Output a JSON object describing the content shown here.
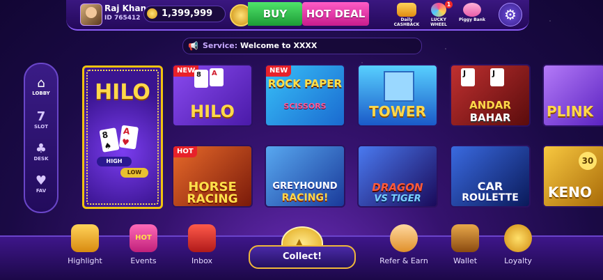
{
  "header": {
    "user_name": "Raj Khan",
    "user_id": "ID 765412",
    "balance": "1,399,999",
    "buy_label": "BUY",
    "hot_deal_label": "HOT DEAL",
    "promos": [
      {
        "name": "daily-cashback",
        "label": "Daily CASHBACK",
        "color": "#f0a030"
      },
      {
        "name": "lucky-wheel",
        "label": "LUCKY WHEEL",
        "color": "#e04c90",
        "badge": "1"
      },
      {
        "name": "piggy-bank",
        "label": "Piggy Bank",
        "color": "#f07ab8"
      }
    ]
  },
  "service": {
    "label": "Service:",
    "message": "Welcome to XXXX"
  },
  "sidebar": {
    "items": [
      {
        "label": "LOBBY",
        "icon": "home-icon",
        "active": true
      },
      {
        "label": "SLOT",
        "icon": "seven-icon"
      },
      {
        "label": "DESK",
        "icon": "club-icon"
      },
      {
        "label": "FAV",
        "icon": "heart-icon"
      }
    ]
  },
  "games": {
    "hilo_big": {
      "title": "HILO",
      "high": "HIGH",
      "low": "LOW"
    },
    "row1": [
      {
        "title_top": "",
        "title": "HILO",
        "tag": "NEW",
        "bg": "#6a2fd0"
      },
      {
        "title_top": "ROCK PAPER",
        "title": "SCISSORS",
        "tag": "NEW",
        "bg": "#1fa3e0"
      },
      {
        "title_top": "",
        "title": "TOWER",
        "tag": "",
        "bg": "#1a5cc8"
      },
      {
        "title_top": "ANDAR",
        "title": "BAHAR",
        "tag": "",
        "bg": "#8a1a1a"
      },
      {
        "title_top": "",
        "title": "PLINK",
        "tag": "",
        "bg": "#7a3ad8"
      }
    ],
    "row2": [
      {
        "title_top": "HORSE",
        "title": "RACING",
        "tag": "HOT",
        "bg": "#b8381a"
      },
      {
        "title_top": "GREYHOUND",
        "title": "RACING!",
        "tag": "",
        "bg": "#2a68c8"
      },
      {
        "title_top": "DRAGON",
        "title": "VS TIGER",
        "tag": "",
        "bg": "#3a2a90"
      },
      {
        "title_top": "CAR",
        "title": "ROULETTE",
        "tag": "",
        "bg": "#1a3a90"
      },
      {
        "title_top": "",
        "title": "KENO",
        "tag": "",
        "bg": "#c88a10"
      }
    ]
  },
  "bottom_nav": {
    "items": [
      {
        "label": "Highlight",
        "icon": "highlight-icon",
        "color": "#e8a020"
      },
      {
        "label": "Events",
        "icon": "events-icon",
        "color": "#e03c8c"
      },
      {
        "label": "Inbox",
        "icon": "inbox-icon",
        "color": "#d82a2a"
      },
      {
        "label": "Refer & Earn",
        "icon": "refer-icon",
        "color": "#f0b860"
      },
      {
        "label": "Wallet",
        "icon": "wallet-icon",
        "color": "#c8882a"
      },
      {
        "label": "Loyalty",
        "icon": "loyalty-icon",
        "color": "#f0b030"
      }
    ],
    "collect_label": "Collect!"
  }
}
